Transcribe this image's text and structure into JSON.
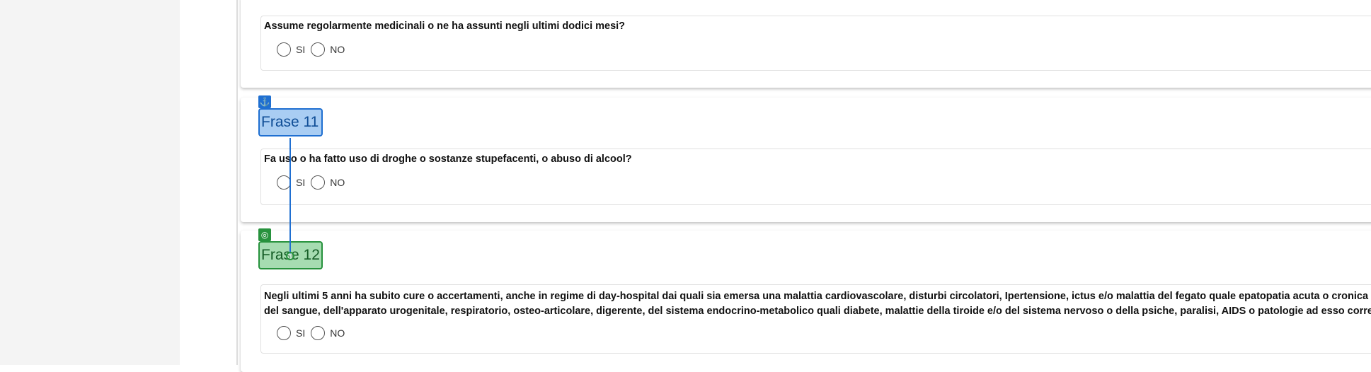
{
  "questions": [
    {
      "text": "Assume regolarmente medicinali o ne ha assunti negli ultimi dodici mesi?",
      "yes": "SI",
      "no": "NO"
    },
    {
      "text": "Fa uso o ha fatto uso di droghe o sostanze stupefacenti, o abuso di alcool?",
      "yes": "SI",
      "no": "NO"
    },
    {
      "line1": "Negli ultimi 5 anni ha subito cure o accertamenti, anche in regime di day-hospital dai quali sia emersa una malattia cardiovascolare, disturbi circolatori, Ipertensione, ictus e/o malattia del fegato quale epatopatia acuta o cronica e",
      "line2": "del sangue, dell'apparato urogenitale, respiratorio, osteo-articolare, digerente, del sistema endocrino-metabolico quali diabete, malattie della tiroide e/o del sistema nervoso o della psiche, paralisi, AIDS o patologie ad esso correla",
      "yes": "SI",
      "no": "NO"
    }
  ],
  "tags": {
    "frase11": "Frase 11",
    "frase12": "Frase 12"
  },
  "icons": {
    "anchor": "anchor-icon",
    "target": "target-icon"
  },
  "colors": {
    "anchor_blue": "#1f6fd1",
    "target_green": "#27923d"
  }
}
